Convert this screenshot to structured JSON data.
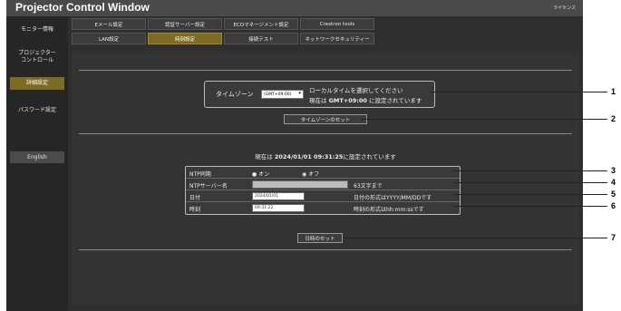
{
  "window": {
    "title": "Projector Control Window",
    "license_link": "ライセンス"
  },
  "sidebar": {
    "items": [
      {
        "label": "モニター情報"
      },
      {
        "label": "プロジェクター\nコントロール"
      },
      {
        "label": "詳細設定"
      },
      {
        "label": "パスワード設定"
      },
      {
        "label": "English"
      }
    ]
  },
  "tabs": [
    {
      "label": "Eメール設定"
    },
    {
      "label": "認証サーバー設定"
    },
    {
      "label": "ECOマネージメント設定"
    },
    {
      "label": "Crestron tools"
    },
    {
      "label": "LAN設定"
    },
    {
      "label": "時刻設定"
    },
    {
      "label": "接続テスト"
    },
    {
      "label": "ネットワークセキュリティー"
    }
  ],
  "timezone": {
    "label": "タイムゾーン",
    "selected": "(GMT+09:00)",
    "message_line1": "ローカルタイムを選択してください",
    "message_prefix": "現在は",
    "message_value": "GMT+09:00",
    "message_suffix": "に設定されています",
    "set_button": "タイムゾーンのセット"
  },
  "current": {
    "prefix": "現在は",
    "datetime": "2024/01/01 09:31:25",
    "suffix": "に設定されています"
  },
  "ntp": {
    "sync_label": "NTP同期",
    "on_label": "● オン",
    "off_label": "◉ オフ",
    "server_label": "NTPサーバー名",
    "server_value": "",
    "server_hint": "63文字まで",
    "date_label": "日付",
    "date_value": "2024/01/01",
    "date_hint": "日付の形式はYYYY/MM/DDです",
    "time_label": "時刻",
    "time_value": "09:31:22",
    "time_hint": "時刻の形式はhh:mm:ssです",
    "set_button": "日時のセット"
  },
  "callouts": [
    "1",
    "2",
    "3",
    "4",
    "5",
    "6",
    "7"
  ]
}
